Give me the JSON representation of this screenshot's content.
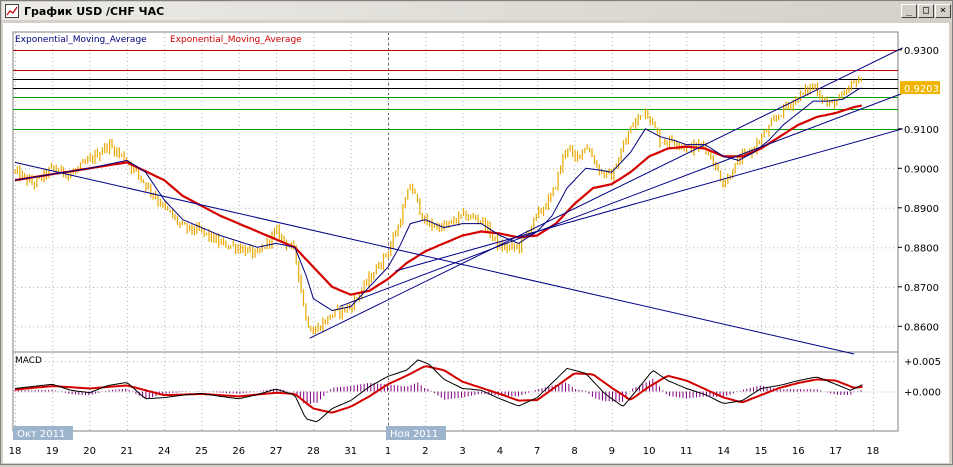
{
  "window": {
    "title": "График USD /CHF ЧАС",
    "minimize_glyph": "_",
    "maximize_glyph": "□",
    "close_glyph": "×"
  },
  "colors": {
    "price": "#e8a800",
    "ema_fast": "#00007f",
    "ema_slow": "#d40000",
    "trend": "#000088",
    "hline_red": "#c00000",
    "hline_green": "#00a000",
    "hline_black": "#000000",
    "grid": "#b0b0b0",
    "macd_hist": "#800080",
    "price_label_bg": "#f0b400",
    "date_label_bg": "#9cb4cc"
  },
  "chart_data": [
    {
      "type": "line",
      "indicator_labels": [
        "Exponential_Moving_Average",
        "Exponential_Moving_Average"
      ],
      "y_ticks": [
        "0.9300",
        "0.9100",
        "0.9000",
        "0.8900",
        "0.8800",
        "0.8700",
        "0.8600"
      ],
      "ylim": [
        0.8535,
        0.9345
      ],
      "current_price_label": "0.9203",
      "current_price": 0.9203,
      "x_ticks": [
        "18",
        "19",
        "20",
        "21",
        "24",
        "25",
        "26",
        "27",
        "28",
        "31",
        "1",
        "2",
        "3",
        "4",
        "7",
        "8",
        "9",
        "10",
        "11",
        "14",
        "15",
        "16",
        "17",
        "18"
      ],
      "month_labels": [
        {
          "label": "Окт 2011",
          "tick": "18"
        },
        {
          "label": "Ноя 2011",
          "tick": "1"
        }
      ],
      "horizontal_levels": [
        {
          "value": 0.93,
          "color": "red"
        },
        {
          "value": 0.925,
          "color": "red"
        },
        {
          "value": 0.9225,
          "color": "black"
        },
        {
          "value": 0.9203,
          "color": "black"
        },
        {
          "value": 0.918,
          "color": "green"
        },
        {
          "value": 0.915,
          "color": "green"
        },
        {
          "value": 0.91,
          "color": "green"
        }
      ],
      "trendlines": [
        {
          "x": [
            0,
            22.5
          ],
          "y": [
            0.9015,
            0.853
          ]
        },
        {
          "x": [
            7.9,
            23.8
          ],
          "y": [
            0.857,
            0.9305
          ]
        },
        {
          "x": [
            8.7,
            23.8
          ],
          "y": [
            0.865,
            0.919
          ]
        },
        {
          "x": [
            10.2,
            23.8
          ],
          "y": [
            0.874,
            0.91
          ]
        }
      ],
      "price_anchors": [
        [
          0,
          0.899
        ],
        [
          0.5,
          0.896
        ],
        [
          1,
          0.9
        ],
        [
          1.5,
          0.8985
        ],
        [
          2,
          0.902
        ],
        [
          2.5,
          0.906
        ],
        [
          3,
          0.902
        ],
        [
          3.5,
          0.896
        ],
        [
          4,
          0.89
        ],
        [
          4.5,
          0.885
        ],
        [
          5,
          0.884
        ],
        [
          5.5,
          0.881
        ],
        [
          6,
          0.88
        ],
        [
          6.5,
          0.878
        ],
        [
          7,
          0.884
        ],
        [
          7.5,
          0.879
        ],
        [
          7.8,
          0.862
        ],
        [
          8,
          0.8585
        ],
        [
          8.5,
          0.863
        ],
        [
          9,
          0.865
        ],
        [
          9.5,
          0.872
        ],
        [
          10,
          0.879
        ],
        [
          10.3,
          0.886
        ],
        [
          10.6,
          0.896
        ],
        [
          11,
          0.886
        ],
        [
          11.5,
          0.885
        ],
        [
          12,
          0.888
        ],
        [
          12.5,
          0.887
        ],
        [
          13,
          0.88
        ],
        [
          13.5,
          0.88
        ],
        [
          14,
          0.888
        ],
        [
          14.4,
          0.893
        ],
        [
          14.8,
          0.906
        ],
        [
          15,
          0.902
        ],
        [
          15.3,
          0.906
        ],
        [
          15.7,
          0.899
        ],
        [
          16,
          0.898
        ],
        [
          16.5,
          0.91
        ],
        [
          16.9,
          0.915
        ],
        [
          17.3,
          0.907
        ],
        [
          17.7,
          0.907
        ],
        [
          18,
          0.905
        ],
        [
          18.5,
          0.906
        ],
        [
          19,
          0.896
        ],
        [
          19.4,
          0.902
        ],
        [
          19.8,
          0.905
        ],
        [
          20.2,
          0.91
        ],
        [
          20.6,
          0.915
        ],
        [
          21,
          0.918
        ],
        [
          21.4,
          0.921
        ],
        [
          21.8,
          0.916
        ],
        [
          22.2,
          0.918
        ],
        [
          22.6,
          0.923
        ],
        [
          22.75,
          0.9203
        ]
      ],
      "ema_fast_anchors": [
        [
          0,
          0.897
        ],
        [
          1,
          0.8985
        ],
        [
          2,
          0.9
        ],
        [
          3,
          0.902
        ],
        [
          3.5,
          0.899
        ],
        [
          4,
          0.892
        ],
        [
          4.5,
          0.887
        ],
        [
          5,
          0.885
        ],
        [
          5.5,
          0.883
        ],
        [
          6,
          0.8815
        ],
        [
          6.5,
          0.88
        ],
        [
          7,
          0.881
        ],
        [
          7.5,
          0.88
        ],
        [
          7.8,
          0.873
        ],
        [
          8,
          0.867
        ],
        [
          8.5,
          0.864
        ],
        [
          9,
          0.865
        ],
        [
          9.5,
          0.87
        ],
        [
          10,
          0.875
        ],
        [
          10.3,
          0.88
        ],
        [
          10.6,
          0.886
        ],
        [
          11,
          0.887
        ],
        [
          11.5,
          0.885
        ],
        [
          12,
          0.886
        ],
        [
          12.5,
          0.886
        ],
        [
          13,
          0.883
        ],
        [
          13.5,
          0.881
        ],
        [
          14,
          0.884
        ],
        [
          14.4,
          0.888
        ],
        [
          14.8,
          0.895
        ],
        [
          15.3,
          0.9
        ],
        [
          15.7,
          0.8995
        ],
        [
          16,
          0.899
        ],
        [
          16.5,
          0.904
        ],
        [
          16.9,
          0.91
        ],
        [
          17.3,
          0.908
        ],
        [
          17.7,
          0.907
        ],
        [
          18,
          0.906
        ],
        [
          18.5,
          0.906
        ],
        [
          19,
          0.903
        ],
        [
          19.4,
          0.902
        ],
        [
          19.8,
          0.904
        ],
        [
          20.2,
          0.907
        ],
        [
          20.6,
          0.911
        ],
        [
          21,
          0.914
        ],
        [
          21.4,
          0.917
        ],
        [
          21.8,
          0.917
        ],
        [
          22.2,
          0.9175
        ],
        [
          22.6,
          0.92
        ],
        [
          22.75,
          0.9205
        ]
      ],
      "ema_slow_anchors": [
        [
          0,
          0.897
        ],
        [
          1,
          0.8985
        ],
        [
          2,
          0.9
        ],
        [
          3,
          0.9015
        ],
        [
          4,
          0.897
        ],
        [
          4.5,
          0.893
        ],
        [
          5,
          0.8905
        ],
        [
          5.5,
          0.888
        ],
        [
          6,
          0.886
        ],
        [
          6.5,
          0.884
        ],
        [
          7,
          0.882
        ],
        [
          7.5,
          0.88
        ],
        [
          8,
          0.875
        ],
        [
          8.5,
          0.87
        ],
        [
          9,
          0.868
        ],
        [
          9.5,
          0.869
        ],
        [
          10,
          0.872
        ],
        [
          10.5,
          0.876
        ],
        [
          11,
          0.879
        ],
        [
          11.5,
          0.881
        ],
        [
          12,
          0.883
        ],
        [
          12.5,
          0.884
        ],
        [
          13,
          0.8835
        ],
        [
          13.5,
          0.8825
        ],
        [
          14,
          0.883
        ],
        [
          14.5,
          0.886
        ],
        [
          15,
          0.891
        ],
        [
          15.5,
          0.895
        ],
        [
          16,
          0.896
        ],
        [
          16.5,
          0.899
        ],
        [
          17,
          0.903
        ],
        [
          17.5,
          0.905
        ],
        [
          18,
          0.9055
        ],
        [
          18.5,
          0.905
        ],
        [
          19,
          0.903
        ],
        [
          19.5,
          0.903
        ],
        [
          20,
          0.905
        ],
        [
          20.5,
          0.908
        ],
        [
          21,
          0.911
        ],
        [
          21.5,
          0.913
        ],
        [
          22,
          0.914
        ],
        [
          22.5,
          0.9155
        ],
        [
          22.75,
          0.916
        ]
      ]
    },
    {
      "type": "line",
      "title": "MACD",
      "y_ticks": [
        "+0.005",
        "+0.000"
      ],
      "ylim": [
        -0.0065,
        0.0065
      ],
      "macd_anchors": [
        [
          0,
          0.0005
        ],
        [
          1,
          0.0012
        ],
        [
          1.5,
          0.0002
        ],
        [
          2,
          -0.0002
        ],
        [
          2.5,
          0.001
        ],
        [
          3,
          0.0015
        ],
        [
          3.5,
          -0.0012
        ],
        [
          4,
          -0.001
        ],
        [
          4.5,
          -0.0006
        ],
        [
          5,
          -0.0003
        ],
        [
          5.5,
          -0.0008
        ],
        [
          6,
          -0.0012
        ],
        [
          6.5,
          -0.0005
        ],
        [
          7,
          0.0004
        ],
        [
          7.5,
          -0.0006
        ],
        [
          7.8,
          -0.0045
        ],
        [
          8.1,
          -0.005
        ],
        [
          8.5,
          -0.0028
        ],
        [
          9,
          -0.0015
        ],
        [
          9.5,
          0.0008
        ],
        [
          10,
          0.0025
        ],
        [
          10.5,
          0.0035
        ],
        [
          10.8,
          0.0052
        ],
        [
          11.1,
          0.0045
        ],
        [
          11.5,
          0.002
        ],
        [
          12,
          0.0005
        ],
        [
          12.5,
          0.0002
        ],
        [
          13,
          -0.0012
        ],
        [
          13.5,
          -0.0024
        ],
        [
          14,
          -0.001
        ],
        [
          14.5,
          0.002
        ],
        [
          14.8,
          0.0038
        ],
        [
          15.3,
          0.003
        ],
        [
          15.8,
          -0.0003
        ],
        [
          16.3,
          -0.0025
        ],
        [
          16.8,
          0.0012
        ],
        [
          17.1,
          0.0035
        ],
        [
          17.5,
          0.0018
        ],
        [
          18,
          0.0005
        ],
        [
          18.5,
          -0.0005
        ],
        [
          19,
          -0.002
        ],
        [
          19.5,
          -0.0015
        ],
        [
          20,
          0.0005
        ],
        [
          20.5,
          0.001
        ],
        [
          21,
          0.0018
        ],
        [
          21.5,
          0.0024
        ],
        [
          22,
          0.0012
        ],
        [
          22.4,
          0.0002
        ],
        [
          22.75,
          0.0012
        ]
      ],
      "signal_anchors": [
        [
          0,
          0.0003
        ],
        [
          1,
          0.0009
        ],
        [
          2,
          0.0005
        ],
        [
          3,
          0.001
        ],
        [
          3.5,
          0.0002
        ],
        [
          4,
          -0.0006
        ],
        [
          5,
          -0.0004
        ],
        [
          6,
          -0.0008
        ],
        [
          7,
          -0.0002
        ],
        [
          7.5,
          -0.0004
        ],
        [
          8,
          -0.0028
        ],
        [
          8.5,
          -0.0035
        ],
        [
          9,
          -0.0025
        ],
        [
          9.5,
          -0.0008
        ],
        [
          10,
          0.0012
        ],
        [
          10.5,
          0.0026
        ],
        [
          11,
          0.0042
        ],
        [
          11.5,
          0.0035
        ],
        [
          12,
          0.0016
        ],
        [
          12.5,
          0.0006
        ],
        [
          13,
          -0.0004
        ],
        [
          13.5,
          -0.0015
        ],
        [
          14,
          -0.0014
        ],
        [
          14.5,
          0.0008
        ],
        [
          15,
          0.003
        ],
        [
          15.5,
          0.0028
        ],
        [
          16,
          0.0006
        ],
        [
          16.5,
          -0.0014
        ],
        [
          17,
          0.0008
        ],
        [
          17.5,
          0.0026
        ],
        [
          18,
          0.0018
        ],
        [
          18.5,
          0.0004
        ],
        [
          19,
          -0.001
        ],
        [
          19.5,
          -0.0018
        ],
        [
          20,
          -0.0006
        ],
        [
          20.5,
          0.0006
        ],
        [
          21,
          0.0014
        ],
        [
          21.5,
          0.002
        ],
        [
          22,
          0.0018
        ],
        [
          22.5,
          0.0006
        ],
        [
          22.75,
          0.0008
        ]
      ]
    }
  ]
}
